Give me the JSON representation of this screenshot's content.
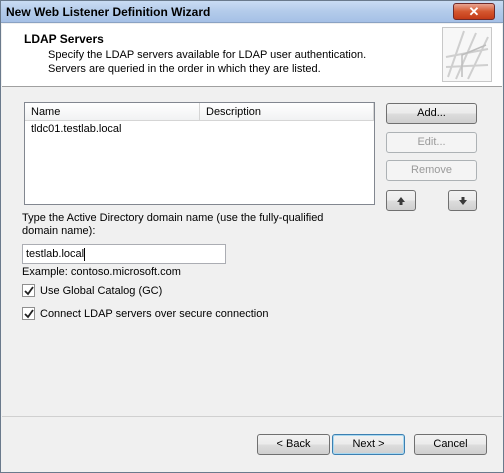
{
  "window": {
    "title": "New Web Listener Definition Wizard",
    "close_glyph": "✕"
  },
  "header": {
    "title": "LDAP Servers",
    "description_line1": "Specify the LDAP servers available for LDAP user authentication.",
    "description_line2": "Servers are queried in the order in which they are listed."
  },
  "server_list": {
    "columns": [
      "Name",
      "Description"
    ],
    "rows": [
      {
        "name": "tldc01.testlab.local",
        "description": ""
      }
    ]
  },
  "side_buttons": {
    "add": "Add...",
    "edit": "Edit...",
    "remove": "Remove",
    "move_up_icon": "arrow-up-icon",
    "move_down_icon": "arrow-down-icon"
  },
  "domain": {
    "label_line1": "Type the Active Directory domain name (use the fully-qualified",
    "label_line2": "domain name):",
    "value": "testlab.local",
    "example": "Example: contoso.microsoft.com"
  },
  "options": {
    "use_gc_label": "Use Global Catalog (GC)",
    "use_gc_checked": true,
    "secure_label": "Connect LDAP servers over secure connection",
    "secure_checked": true
  },
  "footer": {
    "back": "< Back",
    "next": "Next >",
    "cancel": "Cancel"
  },
  "colors": {
    "title_bar": "#b3cbea",
    "close_button": "#c33a17",
    "dialog_bg": "#f0f0f0"
  }
}
